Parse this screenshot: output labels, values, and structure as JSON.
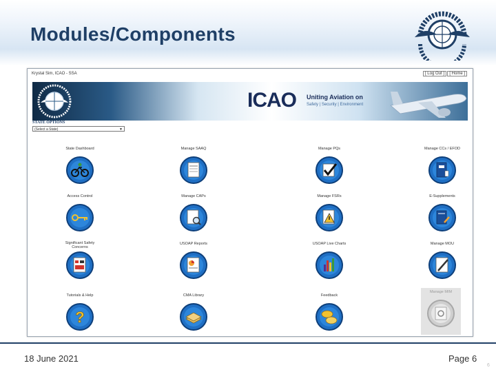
{
  "slide": {
    "title": "Modules/Components",
    "date": "18 June 2021",
    "page": "Page 6",
    "corner_number": "6"
  },
  "colors": {
    "title": "#1f3f66",
    "icon_blue": "#1f6fc4"
  },
  "screenshot": {
    "user_line": "Krystal Sim, ICAO - SSA",
    "logout": "[ Log Out ]",
    "home": "[ Home ]",
    "banner": {
      "brand": "ICAO",
      "slogan": "Uniting Aviation on",
      "subline": "Safety | Security | Environment"
    },
    "state_options_label": "STATE OPTIONS",
    "state_select_value": "(Select a State)",
    "modules": [
      {
        "label": "State Dashboard",
        "icon": "bicycle-icon"
      },
      {
        "label": "Manage SAAQ",
        "icon": "document-icon"
      },
      {
        "label": "Manage PQs",
        "icon": "checkmark-icon"
      },
      {
        "label": "Manage CCs / EFOD",
        "icon": "binder-icon"
      },
      {
        "label": "Access Control",
        "icon": "key-icon"
      },
      {
        "label": "Manage CAPs",
        "icon": "document-search-icon"
      },
      {
        "label": "Manage FSRs",
        "icon": "warning-document-icon"
      },
      {
        "label": "E-Supplements",
        "icon": "book-pen-icon"
      },
      {
        "label": "Significant Safety Concerns",
        "icon": "report-icon"
      },
      {
        "label": "USOAP Reports",
        "icon": "chart-report-icon"
      },
      {
        "label": "USOAP Live Charts",
        "icon": "live-chart-icon"
      },
      {
        "label": "Manage MOU",
        "icon": "pen-icon"
      },
      {
        "label": "Tutorials & Help",
        "icon": "question-icon"
      },
      {
        "label": "CMA Library",
        "icon": "library-icon"
      },
      {
        "label": "Feedback",
        "icon": "chat-bubbles-icon"
      },
      {
        "label": "Manage MIM",
        "icon": "gear-icon"
      }
    ]
  }
}
